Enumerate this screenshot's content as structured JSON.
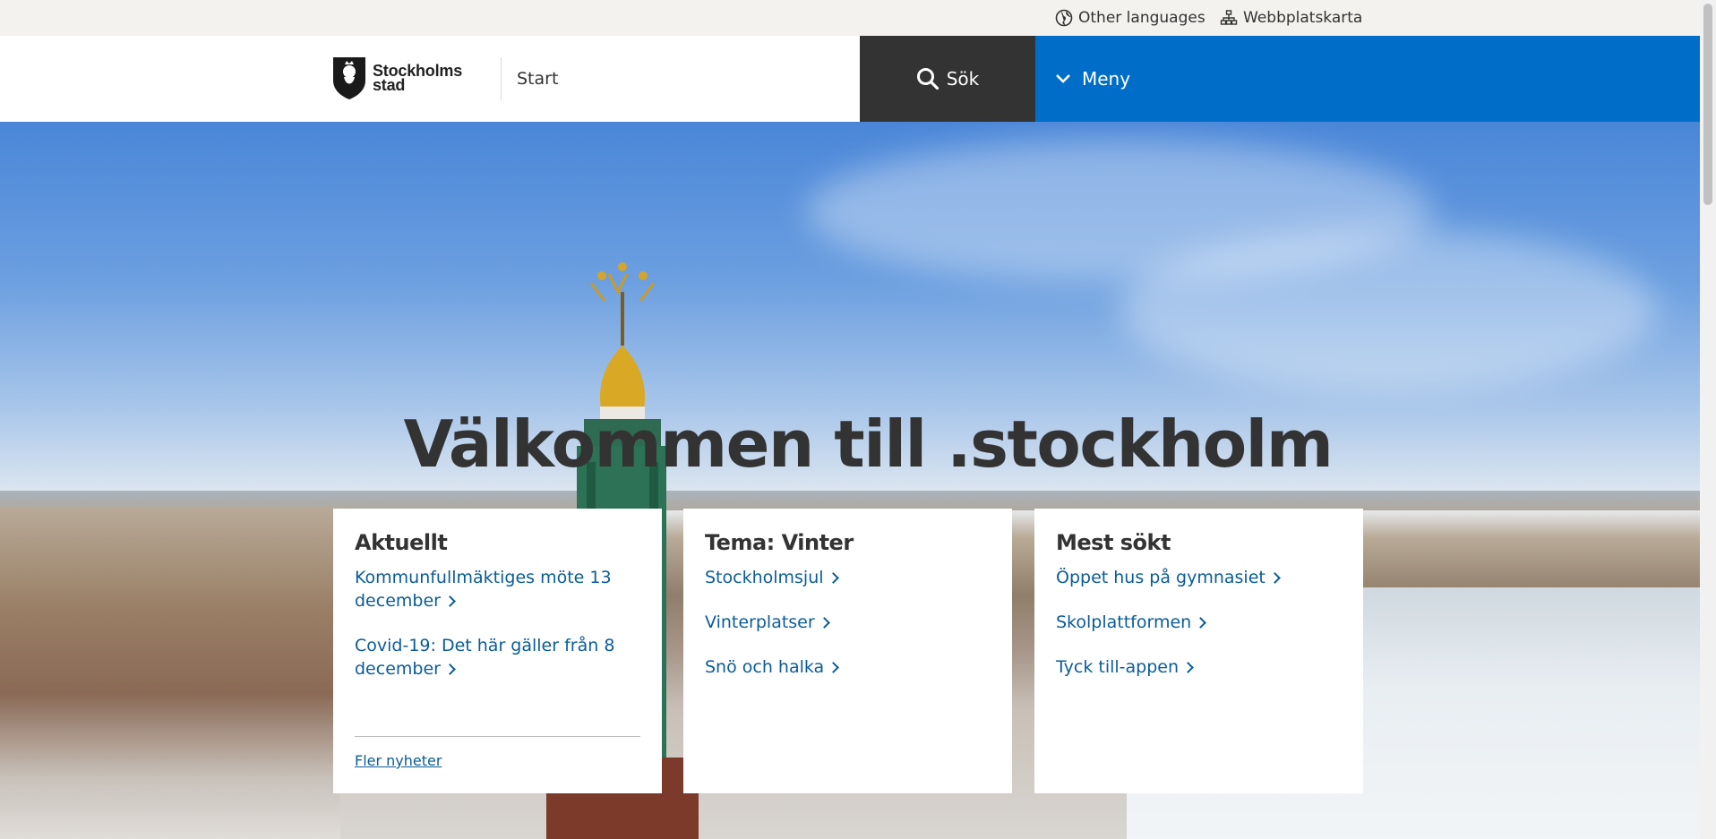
{
  "utility": {
    "languages_label": "Other languages",
    "sitemap_label": "Webbplatskarta"
  },
  "header": {
    "logo_line1": "Stockholms",
    "logo_line2": "stad",
    "breadcrumb": "Start",
    "search_label": "Sök",
    "menu_label": "Meny",
    "search_bg": "#333333",
    "menu_bg": "#006ec8"
  },
  "hero": {
    "title": "Välkommen till .stockholm"
  },
  "cards": [
    {
      "title": "Aktuellt",
      "links": [
        "Kommunfullmäktiges möte 13 december",
        "Covid-19: Det här gäller från 8 december"
      ],
      "more": "Fler nyheter"
    },
    {
      "title": "Tema: Vinter",
      "links": [
        "Stockholmsjul",
        "Vinterplatser",
        "Snö och halka"
      ]
    },
    {
      "title": "Mest sökt",
      "links": [
        "Öppet hus på gymnasiet",
        "Skolplattformen",
        "Tyck till-appen"
      ]
    }
  ],
  "colors": {
    "link": "#0a5c99",
    "accent_blue": "#006ec8"
  }
}
